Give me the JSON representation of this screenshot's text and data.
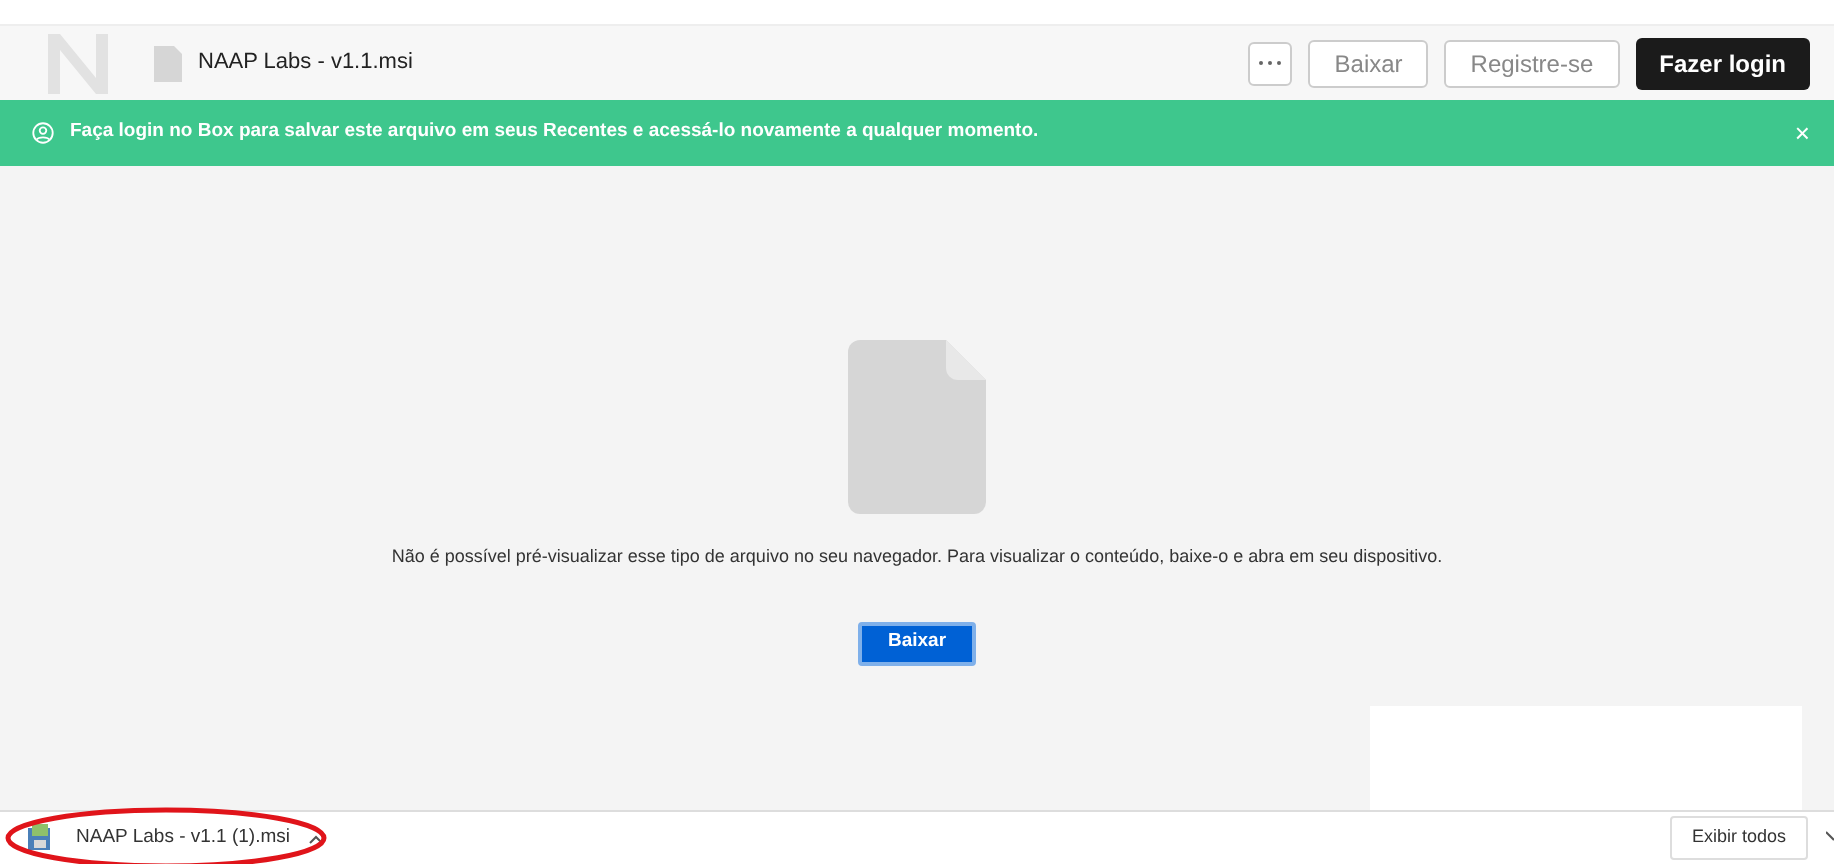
{
  "header": {
    "file_name": "NAAP Labs - v1.1.msi",
    "buttons": [
      {
        "label": "Baixar",
        "kind": "outline"
      },
      {
        "label": "Registre-se",
        "kind": "outline"
      },
      {
        "label": "Fazer login",
        "kind": "primary"
      }
    ]
  },
  "banner": {
    "text": "Faça login no Box para salvar este arquivo em seus Recentes e acessá-lo novamente a qualquer momento.",
    "close": "×"
  },
  "preview": {
    "message": "Não é possível pré-visualizar esse tipo de arquivo no seu navegador. Para visualizar o conteúdo, baixe-o e abra em seu dispositivo.",
    "button": "Baixar"
  },
  "download_bar": {
    "file_name": "NAAP Labs - v1.1 (1).msi",
    "show_all": "Exibir todos"
  }
}
